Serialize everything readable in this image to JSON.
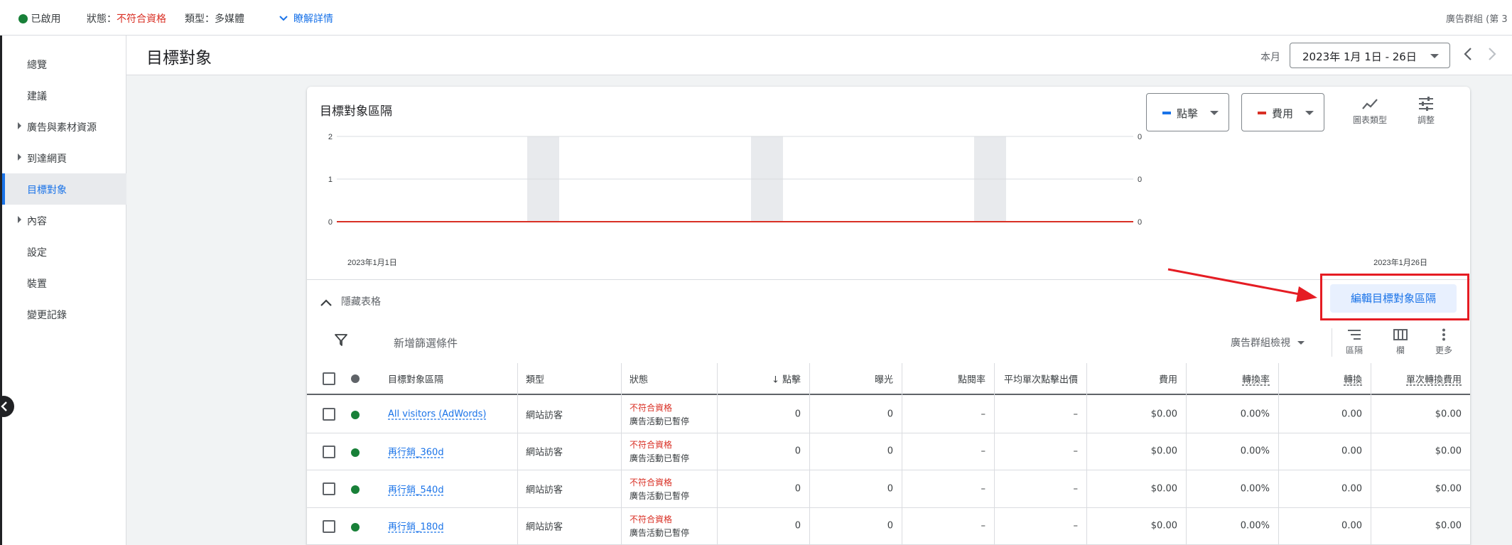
{
  "topbar": {
    "enabled": "已啟用",
    "status_label": "狀態：",
    "status_value": "不符合資格",
    "type_label": "類型：",
    "type_value": "多媒體",
    "details_link": "瞭解詳情",
    "breadcrumb_right": "廣告群組 (第 3"
  },
  "sidebar": {
    "items": [
      {
        "label": "總覽",
        "expandable": false,
        "active": false
      },
      {
        "label": "建議",
        "expandable": false,
        "active": false
      },
      {
        "label": "廣告與素材資源",
        "expandable": true,
        "active": false
      },
      {
        "label": "到達網頁",
        "expandable": true,
        "active": false
      },
      {
        "label": "目標對象",
        "expandable": false,
        "active": true
      },
      {
        "label": "內容",
        "expandable": true,
        "active": false
      },
      {
        "label": "設定",
        "expandable": false,
        "active": false
      },
      {
        "label": "裝置",
        "expandable": false,
        "active": false
      },
      {
        "label": "變更記錄",
        "expandable": false,
        "active": false
      }
    ]
  },
  "header": {
    "title": "目標對象",
    "month_label": "本月",
    "date_range": "2023年 1月 1日 - 26日"
  },
  "card": {
    "title": "目標對象區隔",
    "metric1": {
      "label": "點擊",
      "color": "#1a73e8"
    },
    "metric2": {
      "label": "費用",
      "color": "#d93025"
    },
    "chart_type_label": "圖表類型",
    "adjust_label": "調整",
    "hide_table": "隱藏表格",
    "edit_segments": "編輯目標對象區隔",
    "add_filter": "新增篩選條件",
    "view_select": "廣告群組檢視",
    "tools": {
      "segment": "區隔",
      "columns": "欄",
      "more": "更多"
    }
  },
  "chart_data": {
    "type": "line",
    "x_start_label": "2023年1月1日",
    "x_end_label": "2023年1月26日",
    "y_left_ticks": [
      "2",
      "1",
      "0"
    ],
    "y_right_ticks": [
      "0",
      "0",
      "0"
    ],
    "ylim": [
      0,
      2
    ],
    "grid": true,
    "series": [
      {
        "name": "點擊",
        "values": [
          0,
          0,
          0,
          0,
          0,
          0,
          0,
          0,
          0,
          0,
          0,
          0,
          0,
          0,
          0,
          0,
          0,
          0,
          0,
          0,
          0,
          0,
          0,
          0,
          0,
          0
        ]
      },
      {
        "name": "費用",
        "values": [
          0,
          0,
          0,
          0,
          0,
          0,
          0,
          0,
          0,
          0,
          0,
          0,
          0,
          0,
          0,
          0,
          0,
          0,
          0,
          0,
          0,
          0,
          0,
          0,
          0,
          0
        ]
      }
    ],
    "weekend_bands": [
      [
        7,
        8
      ],
      [
        14,
        15
      ],
      [
        21,
        22
      ]
    ]
  },
  "table": {
    "headers": [
      "目標對象區隔",
      "類型",
      "狀態",
      "點擊",
      "曝光",
      "點閱率",
      "平均單次點擊出價",
      "費用",
      "轉換率",
      "轉換",
      "單次轉換費用"
    ],
    "sort_arrow": "↓",
    "rows": [
      {
        "name": "All visitors (AdWords)",
        "type": "網站訪客",
        "status1": "不符合資格",
        "status2": "廣告活動已暫停",
        "clicks": "0",
        "impr": "0",
        "ctr": "–",
        "avg_cpc": "–",
        "cost": "$0.00",
        "conv_rate": "0.00%",
        "conv": "0.00",
        "cost_conv": "$0.00"
      },
      {
        "name": "再行銷_360d",
        "type": "網站訪客",
        "status1": "不符合資格",
        "status2": "廣告活動已暫停",
        "clicks": "0",
        "impr": "0",
        "ctr": "–",
        "avg_cpc": "–",
        "cost": "$0.00",
        "conv_rate": "0.00%",
        "conv": "0.00",
        "cost_conv": "$0.00"
      },
      {
        "name": "再行銷_540d",
        "type": "網站訪客",
        "status1": "不符合資格",
        "status2": "廣告活動已暫停",
        "clicks": "0",
        "impr": "0",
        "ctr": "–",
        "avg_cpc": "–",
        "cost": "$0.00",
        "conv_rate": "0.00%",
        "conv": "0.00",
        "cost_conv": "$0.00"
      },
      {
        "name": "再行銷_180d",
        "type": "網站訪客",
        "status1": "不符合資格",
        "status2": "廣告活動已暫停",
        "clicks": "0",
        "impr": "0",
        "ctr": "–",
        "avg_cpc": "–",
        "cost": "$0.00",
        "conv_rate": "0.00%",
        "conv": "0.00",
        "cost_conv": "$0.00"
      }
    ]
  },
  "colors": {
    "status_enabled": "#188038",
    "accent": "#1a73e8",
    "alert": "#d93025",
    "annotation": "#e51c23"
  }
}
